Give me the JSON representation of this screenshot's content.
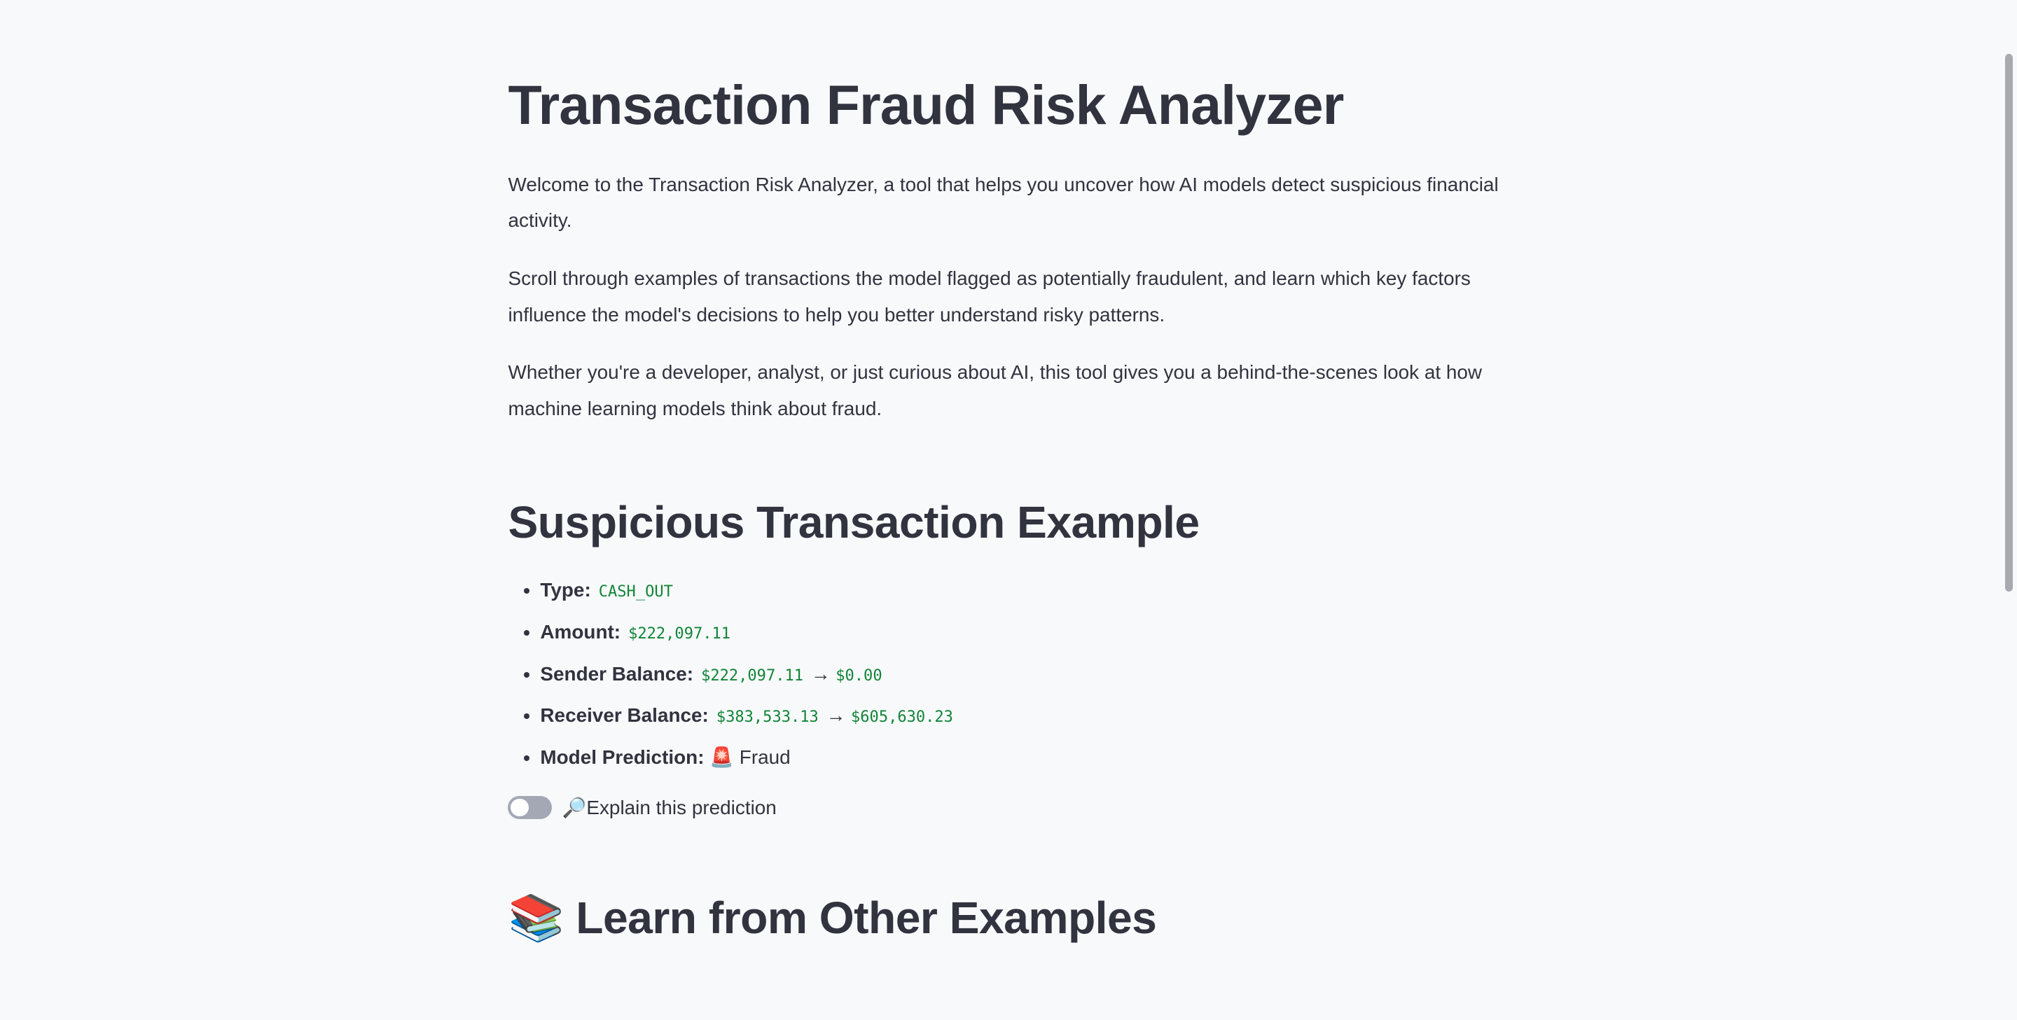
{
  "header": {
    "title": "Transaction Fraud Risk Analyzer",
    "paragraphs": [
      "Welcome to the Transaction Risk Analyzer, a tool that helps you uncover how AI models detect suspicious financial activity.",
      "Scroll through examples of transactions the model flagged as potentially fraudulent, and learn which key factors influence the model's decisions to help you better understand risky patterns.",
      "Whether you're a developer, analyst, or just curious about AI, this tool gives you a behind-the-scenes look at how machine learning models think about fraud."
    ]
  },
  "example": {
    "heading": "Suspicious Transaction Example",
    "type_label": "Type:",
    "type_value": "CASH_OUT",
    "amount_label": "Amount:",
    "amount_value": "$222,097.11",
    "sender_label": "Sender Balance:",
    "sender_before": "$222,097.11",
    "sender_after": "$0.00",
    "receiver_label": "Receiver Balance:",
    "receiver_before": "$383,533.13",
    "receiver_after": "$605,630.23",
    "arrow": "→",
    "prediction_label": "Model Prediction:",
    "prediction_icon": "🚨",
    "prediction_value": "Fraud",
    "value_color": "#118537"
  },
  "explain_toggle": {
    "icon": "🔎",
    "label": "Explain this prediction",
    "checked": false
  },
  "learn": {
    "icon": "📚",
    "heading": "Learn from Other Examples"
  }
}
